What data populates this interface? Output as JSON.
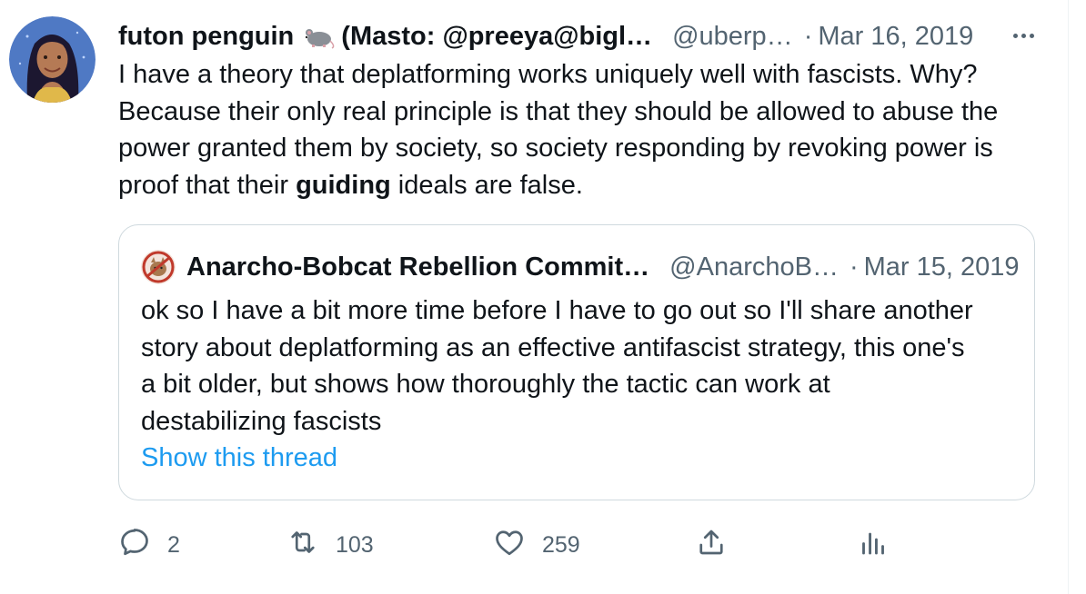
{
  "tweet": {
    "author_name": "futon penguin",
    "author_suffix": "(Masto: @preeya@bigl…",
    "handle": "@uberp…",
    "separator": "·",
    "date": "Mar 16, 2019",
    "text_lines": [
      "I have a theory that deplatforming works uniquely well with fascists. Why?",
      "Because their only real principle is that they should be allowed to abuse the",
      "power granted them by society, so society responding by revoking power is"
    ],
    "last_line_pre": "proof that their ",
    "last_line_bold": "guiding",
    "last_line_post": " ideals are false."
  },
  "quote": {
    "author_name": "Anarcho-Bobcat Rebellion Commit…",
    "handle": "@AnarchoB…",
    "separator": "·",
    "date": "Mar 15, 2019",
    "text_lines": [
      "ok so I have a bit more time before I have to go out so I'll share another",
      "story about deplatforming as an effective antifascist strategy, this one's",
      "a bit older, but shows how thoroughly the tactic can work at",
      "destabilizing fascists"
    ],
    "show_thread": "Show this thread"
  },
  "actions": {
    "replies": "2",
    "retweets": "103",
    "likes": "259"
  },
  "colors": {
    "link": "#1d9bf0",
    "secondary_text": "#536471",
    "border": "#cfd9de"
  },
  "icons": [
    "more-icon",
    "reply-icon",
    "retweet-icon",
    "like-icon",
    "share-icon",
    "analytics-icon",
    "rat-emoji-icon"
  ]
}
